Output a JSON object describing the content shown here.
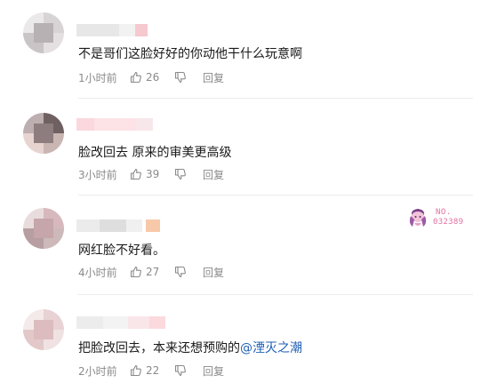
{
  "comments": [
    {
      "text": "不是哥们这脸好好的你动他干什么玩意啊",
      "time": "1小时前",
      "likes": "26",
      "reply_label": "回复",
      "like_icon": "thumbs-up-icon",
      "dislike_icon": "thumbs-down-icon"
    },
    {
      "text": "脸改回去 原来的审美更高级",
      "time": "3小时前",
      "likes": "39",
      "reply_label": "回复",
      "like_icon": "thumbs-up-icon",
      "dislike_icon": "thumbs-down-icon"
    },
    {
      "text": "网红脸不好看。",
      "time": "4小时前",
      "likes": "27",
      "reply_label": "回复",
      "like_icon": "thumbs-up-icon",
      "dislike_icon": "thumbs-down-icon",
      "badge": {
        "label": "NO.",
        "number": "032389"
      }
    },
    {
      "text_prefix": "把脸改回去，本来还想预购的",
      "mention": "@湮灭之潮",
      "time": "2小时前",
      "likes": "22",
      "reply_label": "回复",
      "like_icon": "thumbs-up-icon",
      "dislike_icon": "thumbs-down-icon"
    }
  ],
  "colors": {
    "text": "#1a1a1a",
    "meta": "#8a8a8a",
    "mention": "#1f5fb4",
    "divider": "#ececec",
    "badge": "#e06fa2"
  }
}
